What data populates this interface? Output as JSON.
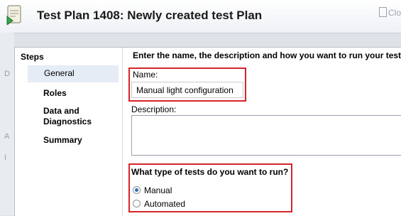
{
  "window": {
    "title": "Test Plan 1408: Newly created test Plan",
    "close_label": "Clo"
  },
  "background_letters": [
    "D",
    "A",
    "I"
  ],
  "steps": {
    "header": "Steps",
    "items": [
      {
        "label": "General",
        "selected": true
      },
      {
        "label": "Roles",
        "selected": false
      },
      {
        "label": "Data and Diagnostics",
        "selected": false
      },
      {
        "label": "Summary",
        "selected": false
      }
    ]
  },
  "general": {
    "instruction": "Enter the name, the description and how you want to run your tests",
    "name_label": "Name:",
    "name_value": "Manual light configuration",
    "description_label": "Description:",
    "description_value": "",
    "run_question": "What type of tests do you want to run?",
    "options": [
      {
        "label": "Manual",
        "checked": true
      },
      {
        "label": "Automated",
        "checked": false
      }
    ]
  },
  "colors": {
    "highlight_border": "#d8232a",
    "selected_step_bg": "#e6ecf5",
    "radio_dot": "#2f6fb5"
  }
}
